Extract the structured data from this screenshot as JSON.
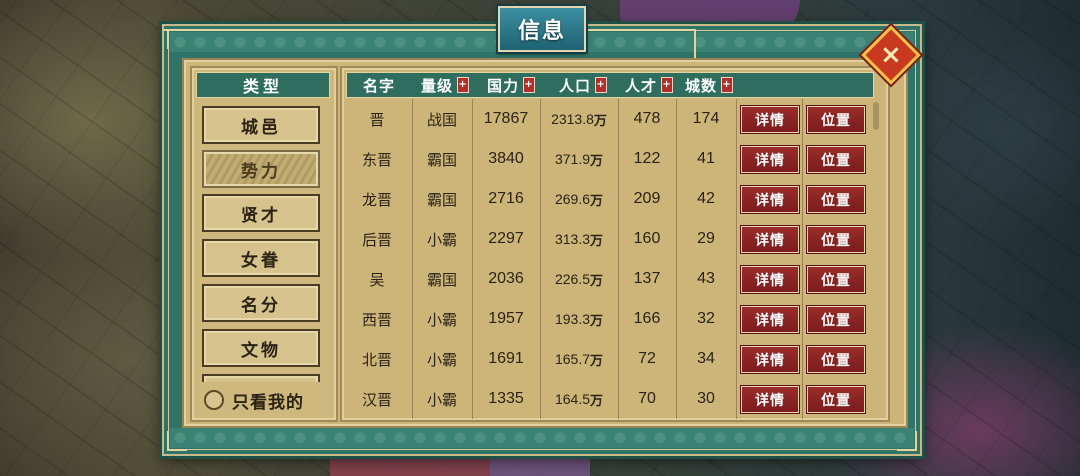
{
  "dialog": {
    "title": "信息",
    "close_label": "×"
  },
  "sidebar": {
    "header": "类型",
    "items": [
      {
        "label": "城邑",
        "active": false
      },
      {
        "label": "势力",
        "active": true
      },
      {
        "label": "贤才",
        "active": false
      },
      {
        "label": "女眷",
        "active": false
      },
      {
        "label": "名分",
        "active": false
      },
      {
        "label": "文物",
        "active": false
      }
    ],
    "only_mine_label": "只看我的"
  },
  "table": {
    "columns": [
      {
        "key": "name",
        "label": "名字",
        "sortable": false
      },
      {
        "key": "level",
        "label": "量级",
        "sortable": true
      },
      {
        "key": "power",
        "label": "国力",
        "sortable": true
      },
      {
        "key": "population",
        "label": "人口",
        "sortable": true
      },
      {
        "key": "talent",
        "label": "人才",
        "sortable": true
      },
      {
        "key": "cities",
        "label": "城数",
        "sortable": true
      }
    ],
    "sort_icon": "+",
    "detail_label": "详情",
    "location_label": "位置",
    "rows": [
      {
        "name": "晋",
        "level": "战国",
        "power": "17867",
        "pop_num": "2313.8",
        "pop_unit": "万",
        "talent": "478",
        "cities": "174"
      },
      {
        "name": "东晋",
        "level": "霸国",
        "power": "3840",
        "pop_num": "371.9",
        "pop_unit": "万",
        "talent": "122",
        "cities": "41"
      },
      {
        "name": "龙晋",
        "level": "霸国",
        "power": "2716",
        "pop_num": "269.6",
        "pop_unit": "万",
        "talent": "209",
        "cities": "42"
      },
      {
        "name": "后晋",
        "level": "小霸",
        "power": "2297",
        "pop_num": "313.3",
        "pop_unit": "万",
        "talent": "160",
        "cities": "29"
      },
      {
        "name": "吴",
        "level": "霸国",
        "power": "2036",
        "pop_num": "226.5",
        "pop_unit": "万",
        "talent": "137",
        "cities": "43"
      },
      {
        "name": "西晋",
        "level": "小霸",
        "power": "1957",
        "pop_num": "193.3",
        "pop_unit": "万",
        "talent": "166",
        "cities": "32"
      },
      {
        "name": "北晋",
        "level": "小霸",
        "power": "1691",
        "pop_num": "165.7",
        "pop_unit": "万",
        "talent": "72",
        "cities": "34"
      },
      {
        "name": "汉晋",
        "level": "小霸",
        "power": "1335",
        "pop_num": "164.5",
        "pop_unit": "万",
        "talent": "70",
        "cities": "30"
      }
    ]
  },
  "colors": {
    "frame": "#2f7467",
    "paper": "#cdb57a",
    "header": "#2f6e5f",
    "button_red": "#8a2526",
    "close": "#c8391f"
  }
}
